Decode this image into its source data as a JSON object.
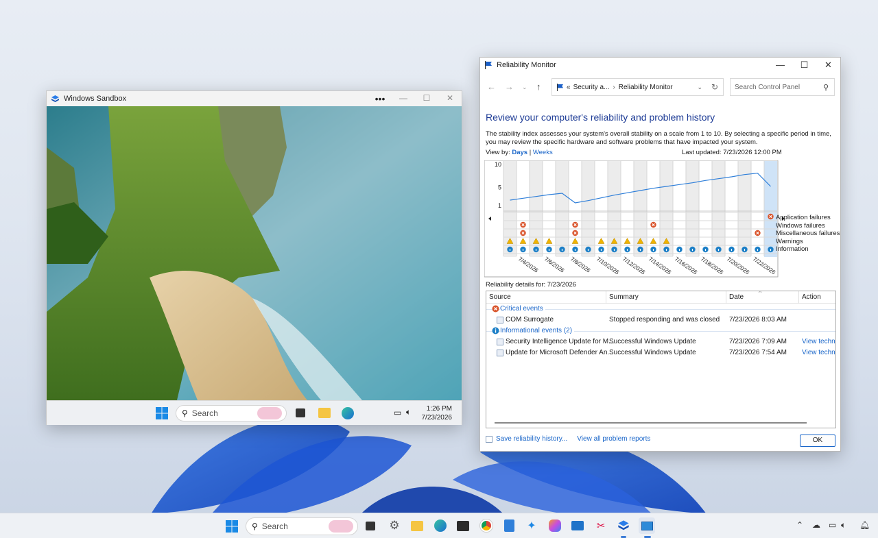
{
  "sandbox": {
    "title": "Windows Sandbox",
    "taskbar": {
      "search_placeholder": "Search",
      "time": "1:26 PM",
      "date": "7/23/2026"
    }
  },
  "reliability": {
    "title": "Reliability Monitor",
    "breadcrumb": {
      "prefix": "«",
      "parent": "Security a...",
      "current": "Reliability Monitor"
    },
    "search_placeholder": "Search Control Panel",
    "heading": "Review your computer's reliability and problem history",
    "description": "The stability index assesses your system's overall stability on a scale from 1 to 10. By selecting a specific period in time, you may review the specific hardware and software problems that have impacted your system.",
    "view_by_label": "View by:",
    "view_days": "Days",
    "view_sep": "|",
    "view_weeks": "Weeks",
    "last_updated": "Last updated: 7/23/2026 12:00 PM",
    "details_for": "Reliability details for: 7/23/2026",
    "table": {
      "columns": [
        "Source",
        "Summary",
        "Date",
        "Action"
      ],
      "critical_label": "Critical events",
      "critical_rows": [
        {
          "source": "COM Surrogate",
          "summary": "Stopped responding and was closed",
          "date": "7/23/2026 8:03 AM",
          "action": ""
        }
      ],
      "info_label": "Informational events (2)",
      "info_rows": [
        {
          "source": "Security Intelligence Update for M...",
          "summary": "Successful Windows Update",
          "date": "7/23/2026 7:09 AM",
          "action": "View technic"
        },
        {
          "source": "Update for Microsoft Defender An...",
          "summary": "Successful Windows Update",
          "date": "7/23/2026 7:54 AM",
          "action": "View technic"
        }
      ]
    },
    "footer": {
      "save": "Save reliability history...",
      "view_all": "View all problem reports",
      "ok": "OK"
    },
    "colors": {
      "accent": "#1a66c9",
      "heading": "#1e3c96",
      "critical": "#d9532a",
      "warning": "#f0b400",
      "info": "#1c7fc7"
    }
  },
  "chart_data": {
    "type": "line",
    "title": "",
    "ylabel": "",
    "ylim": [
      1,
      10
    ],
    "yticks": [
      10,
      5,
      1
    ],
    "x_labels": [
      "7/4/2026",
      "7/6/2026",
      "7/8/2026",
      "7/10/2026",
      "7/12/2026",
      "7/14/2026",
      "7/16/2026",
      "7/18/2026",
      "7/20/2026",
      "7/22/2026"
    ],
    "days": [
      "7/3",
      "7/4",
      "7/5",
      "7/6",
      "7/7",
      "7/8",
      "7/9",
      "7/10",
      "7/11",
      "7/12",
      "7/13",
      "7/14",
      "7/15",
      "7/16",
      "7/17",
      "7/18",
      "7/19",
      "7/20",
      "7/21",
      "7/22",
      "7/23"
    ],
    "stability": [
      2.2,
      2.6,
      3.0,
      3.4,
      3.7,
      1.6,
      2.1,
      2.7,
      3.3,
      3.8,
      4.3,
      4.8,
      5.2,
      5.6,
      6.0,
      6.5,
      6.9,
      7.3,
      7.8,
      8.1,
      5.2
    ],
    "legend": [
      "Application failures",
      "Windows failures",
      "Miscellaneous failures",
      "Warnings",
      "Information"
    ],
    "events": {
      "application_failures": [
        20
      ],
      "windows_failures": [
        1,
        5,
        11
      ],
      "miscellaneous_failures": [
        1,
        5,
        19
      ],
      "warnings": [
        0,
        1,
        2,
        3,
        5,
        7,
        8,
        9,
        10,
        11,
        12
      ],
      "information": [
        0,
        1,
        2,
        3,
        4,
        5,
        6,
        7,
        8,
        9,
        10,
        11,
        12,
        13,
        14,
        15,
        16,
        17,
        18,
        19,
        20
      ]
    },
    "selected_day": 20
  },
  "taskbar": {
    "search_placeholder": "Search"
  }
}
